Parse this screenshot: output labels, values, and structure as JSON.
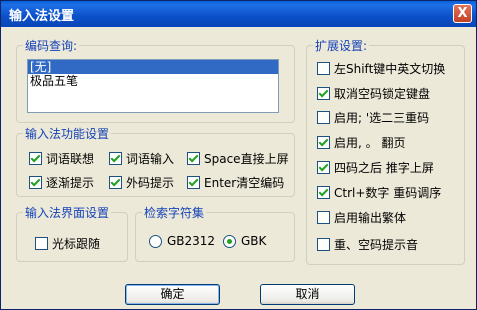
{
  "window": {
    "title": "输入法设置",
    "close_label": "X"
  },
  "encoding_lookup": {
    "legend": "编码查询:",
    "items": [
      "[无]",
      "极品五笔"
    ],
    "selected_index": 0
  },
  "features": {
    "legend": "输入法功能设置",
    "options": [
      {
        "label": "词语联想",
        "checked": true
      },
      {
        "label": "词语输入",
        "checked": true
      },
      {
        "label": "Space直接上屏",
        "checked": true
      },
      {
        "label": "逐渐提示",
        "checked": true
      },
      {
        "label": "外码提示",
        "checked": true
      },
      {
        "label": "Enter清空编码",
        "checked": true
      }
    ]
  },
  "interface": {
    "legend": "输入法界面设置",
    "cursor_follow": {
      "label": "光标跟随",
      "checked": false
    }
  },
  "charset": {
    "legend": "检索字符集",
    "options": [
      {
        "label": "GB2312",
        "selected": false
      },
      {
        "label": "GBK",
        "selected": true
      }
    ]
  },
  "extended": {
    "legend": "扩展设置:",
    "options": [
      {
        "label": "左Shift键中英文切换",
        "checked": false
      },
      {
        "label": "取消空码锁定键盘",
        "checked": true
      },
      {
        "label": "启用; '选二三重码",
        "checked": false
      },
      {
        "label": "启用, 。 翻页",
        "checked": true
      },
      {
        "label": "四码之后 推字上屏",
        "checked": true
      },
      {
        "label": "Ctrl+数字 重码调序",
        "checked": true
      },
      {
        "label": "启用输出繁体",
        "checked": false
      },
      {
        "label": "重、空码提示音",
        "checked": false
      }
    ]
  },
  "buttons": {
    "ok": "确定",
    "cancel": "取消"
  }
}
